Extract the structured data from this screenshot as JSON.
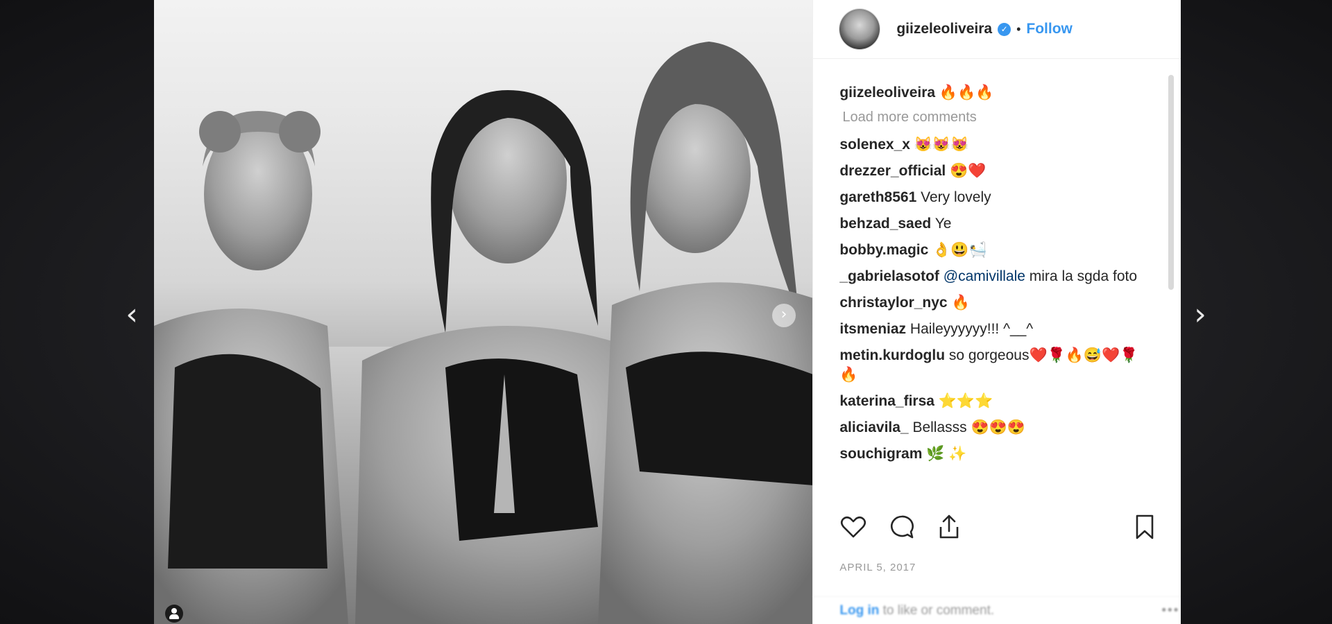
{
  "nav": {
    "prev": "‹",
    "next": "›"
  },
  "post": {
    "username": "giizeleoliveira",
    "follow_label": "Follow",
    "dot": "•",
    "verified_glyph": "✓",
    "carousel_next": "›"
  },
  "caption": {
    "user": "giizeleoliveira",
    "text": " 🔥🔥🔥"
  },
  "load_more": "Load more comments",
  "comments": [
    {
      "user": "solenex_x",
      "text": " 😻😻😻"
    },
    {
      "user": "drezzer_official",
      "text": " 😍❤️"
    },
    {
      "user": "gareth8561",
      "text": " Very lovely"
    },
    {
      "user": "behzad_saed",
      "text": " Ye"
    },
    {
      "user": "bobby.magic",
      "text": " 👌😃🛀"
    },
    {
      "user": "_gabrielasotof",
      "mention": "@camivillale",
      "text": " mira la sgda foto"
    },
    {
      "user": "christaylor_nyc",
      "text": " 🔥"
    },
    {
      "user": "itsmeniaz",
      "text": " Haileyyyyyy!!! ^__^"
    },
    {
      "user": "metin.kurdoglu",
      "text": " so gorgeous❤️🌹🔥😅❤️🌹🔥"
    },
    {
      "user": "katerina_firsa",
      "text": " ⭐⭐⭐"
    },
    {
      "user": "aliciavila_",
      "text": " Bellasss 😍😍😍"
    },
    {
      "user": "souchigram",
      "text": " 🌿 ✨"
    }
  ],
  "date": "APRIL 5, 2017",
  "login": {
    "link": "Log in",
    "rest": " to like or comment.",
    "more": "•••"
  },
  "colors": {
    "accent": "#3897f0",
    "text": "#262626",
    "muted": "#999999"
  }
}
